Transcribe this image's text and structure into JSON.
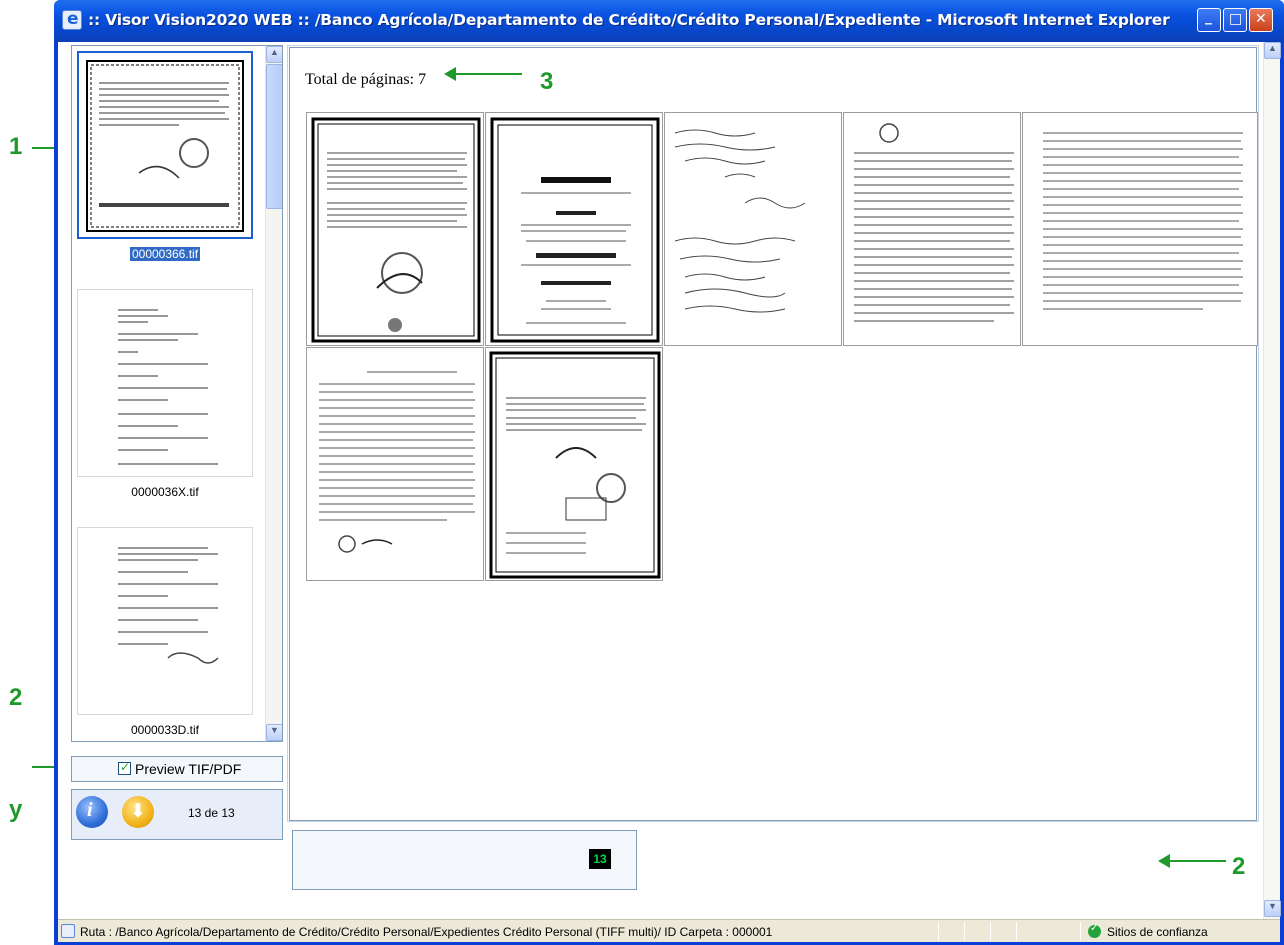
{
  "window": {
    "title": ":: Visor Vision2020 WEB ::  /Banco Agrícola/Departamento de Crédito/Crédito Personal/Expediente - Microsoft Internet Explorer",
    "minimize_symbol": "_",
    "maximize_symbol": "□",
    "close_symbol": "✕"
  },
  "thumbnails": [
    {
      "label": "00000366.tif",
      "selected": true
    },
    {
      "label": "0000036X.tif",
      "selected": false
    },
    {
      "label": "0000033D.tif",
      "selected": false
    }
  ],
  "preview": {
    "label": "Preview TIF/PDF",
    "checked": true
  },
  "nav": {
    "info_icon": "info-icon",
    "download_icon": "download-icon",
    "page_count": "13 de 13"
  },
  "viewer": {
    "total_pages": "Total de páginas: 7",
    "page_count": 7
  },
  "counter": {
    "value": "13"
  },
  "statusbar": {
    "path": "Ruta :  /Banco Agrícola/Departamento de Crédito/Crédito Personal/Expedientes Crédito Personal (TIFF multi)/ ID Carpeta : 000001",
    "zone": "Sitios de confianza"
  },
  "annotations": {
    "a1": "1",
    "a2_left": "2",
    "a_y": "y",
    "a3": "3",
    "a2_right": "2"
  },
  "colors": {
    "titlebar": "#0a52e0",
    "annotation": "#1d9a2a",
    "selection": "#316ac5",
    "counter_text": "#00d64a"
  }
}
